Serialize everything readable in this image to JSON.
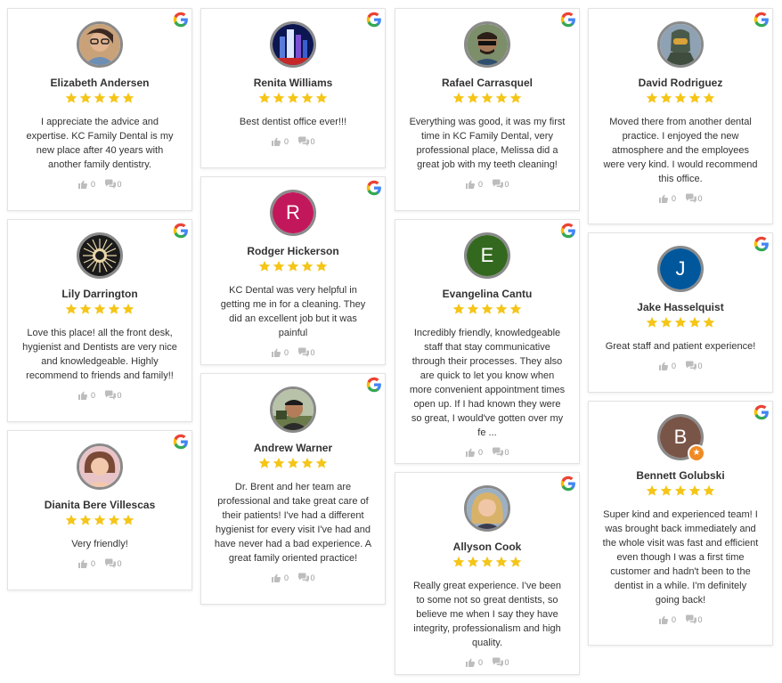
{
  "colors": {
    "star": "#f5c518",
    "avatar_border": "#8a8a8a",
    "icon_gray": "#bdbdbd"
  },
  "reviews": [
    {
      "name": "Elizabeth Andersen",
      "rating": 5,
      "text": "I appreciate the advice and expertise. KC Family Dental is my new place after 40 years with another family dentistry.",
      "likes": "0",
      "comments": "0",
      "avatar": "photo-woman-glasses-icon"
    },
    {
      "name": "Renita Williams",
      "rating": 5,
      "text": "Best dentist office ever!!!",
      "likes": "0",
      "comments": "0",
      "avatar": "photo-city-lights-icon"
    },
    {
      "name": "Rafael Carrasquel",
      "rating": 5,
      "text": "Everything was good, it was my first time in KC Family Dental, very professional place, Melissa did a great job with my teeth cleaning!",
      "likes": "0",
      "comments": "0",
      "avatar": "photo-man-sunglasses-icon"
    },
    {
      "name": "David Rodriguez",
      "rating": 5,
      "text": "Moved there from another dental practice. I enjoyed the new atmosphere and the employees were very kind. I would recommend this office.",
      "likes": "0",
      "comments": "0",
      "avatar": "photo-armor-helmet-icon"
    },
    {
      "name": "Lily Darrington",
      "rating": 5,
      "text": "Love this place! all the front desk, hygienist and Dentists are very nice and knowledgeable. Highly recommend to friends and family!!",
      "likes": "0",
      "comments": "0",
      "avatar": "photo-sun-emblem-icon"
    },
    {
      "name": "Rodger Hickerson",
      "rating": 5,
      "text": "KC Dental was very helpful in getting me in for a cleaning. They did an excellent job but it was painful",
      "likes": "0",
      "comments": "0",
      "avatar_letter": "R",
      "avatar_color": "#c2185b"
    },
    {
      "name": "Evangelina Cantu",
      "rating": 5,
      "text": "Incredibly friendly, knowledgeable staff that stay communicative through their processes. They also are quick to let you know when more convenient appointment times open up. If I had known they were so great, I would've gotten over my fe ...",
      "likes": "0",
      "comments": "0",
      "avatar_letter": "E",
      "avatar_color": "#33691e"
    },
    {
      "name": "Jake Hasselquist",
      "rating": 5,
      "text": "Great staff and patient experience!",
      "likes": "0",
      "comments": "0",
      "avatar_letter": "J",
      "avatar_color": "#01579b"
    },
    {
      "name": "Dianita Bere Villescas",
      "rating": 5,
      "text": "Very friendly!",
      "likes": "0",
      "comments": "0",
      "avatar": "photo-woman-portrait-icon"
    },
    {
      "name": "Andrew Warner",
      "rating": 5,
      "text": "Dr. Brent and her team are professional and take great care of their patients! I've had a different hygienist for every visit I've had and have never had a bad experience. A great family oriented practice!",
      "likes": "0",
      "comments": "0",
      "avatar": "photo-man-outdoors-icon"
    },
    {
      "name": "Allyson Cook",
      "rating": 5,
      "text": "Really great experience. I've been to some not so great dentists, so believe me when I say they have integrity, professionalism and high quality.",
      "likes": "0",
      "comments": "0",
      "avatar": "photo-woman-blonde-icon"
    },
    {
      "name": "Bennett Golubski",
      "rating": 5,
      "text": "Super kind and experienced team! I was brought back immediately and the whole visit was fast and efficient even though I was a first time customer and hadn't been to the dentist in a while. I'm definitely going back!",
      "likes": "0",
      "comments": "0",
      "avatar_letter": "B",
      "avatar_color": "#795548",
      "badge": "local-guide-star-icon"
    }
  ]
}
